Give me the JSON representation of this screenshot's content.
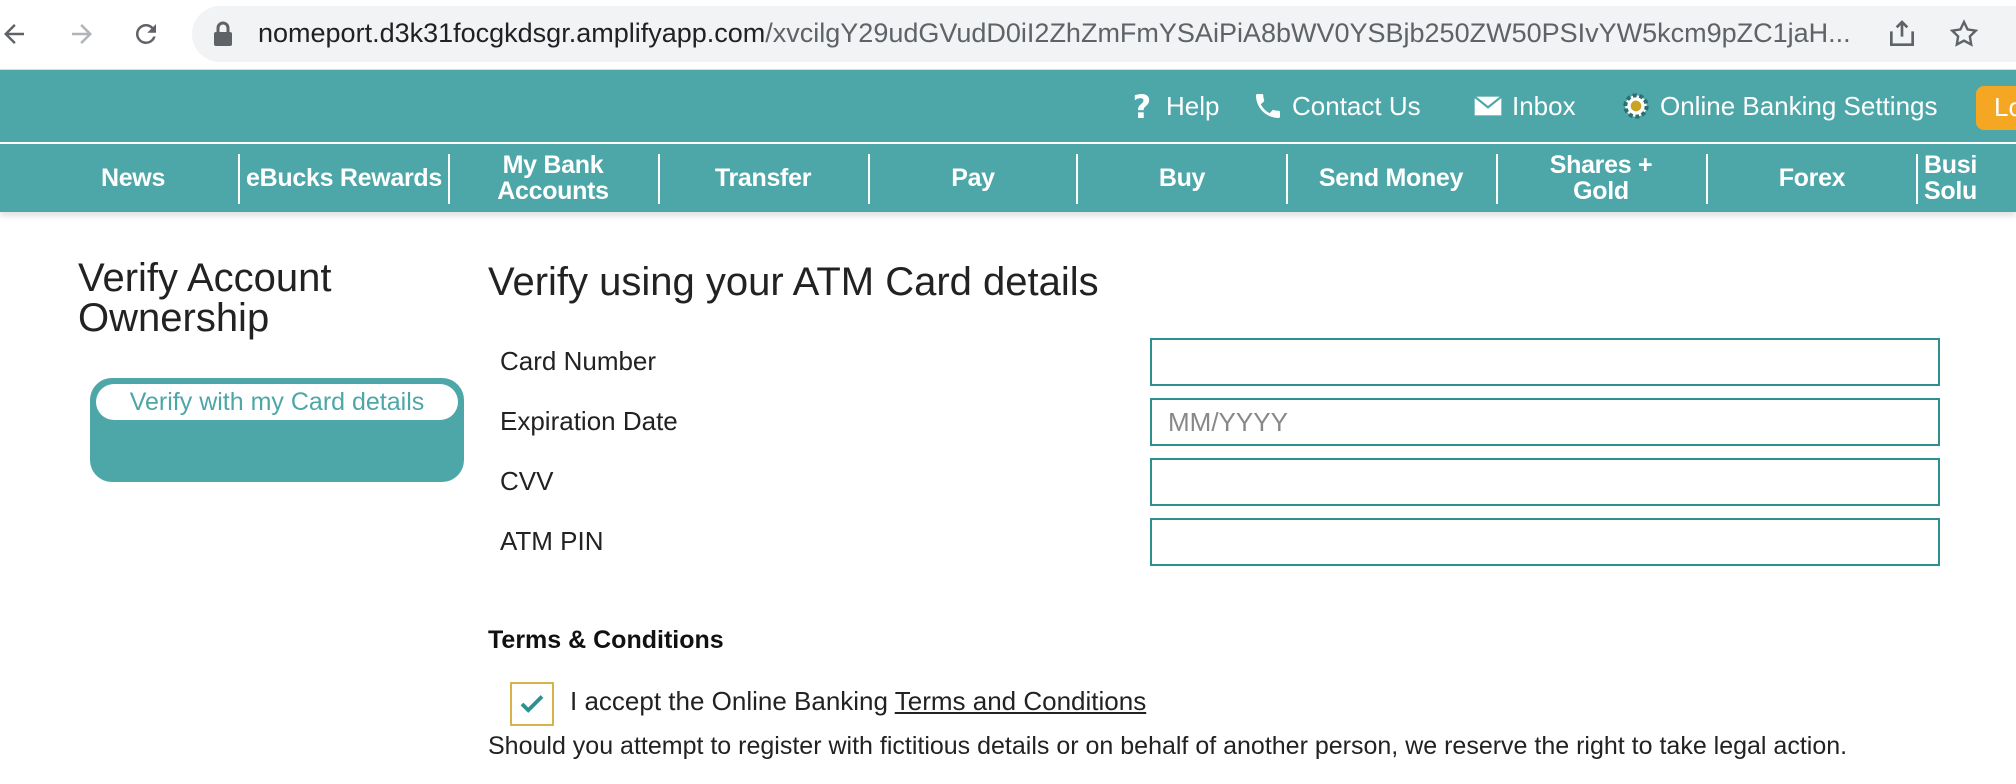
{
  "browser": {
    "url_host": "nomeport.d3k31focgkdsgr.amplifyapp.com",
    "url_path": "/xvcilgY29udGVudD0iI2ZhZmFmYSAiPiA8bWV0YSBjb250ZW50PSIvYW5kcm9pZC1jaH..."
  },
  "topbar": {
    "help": "Help",
    "contact": "Contact Us",
    "inbox": "Inbox",
    "settings": "Online Banking Settings",
    "login": "Lo"
  },
  "mainnav": [
    {
      "label": "News"
    },
    {
      "label": "eBucks Rewards"
    },
    {
      "label": "My Bank\nAccounts"
    },
    {
      "label": "Transfer"
    },
    {
      "label": "Pay"
    },
    {
      "label": "Buy"
    },
    {
      "label": "Send Money"
    },
    {
      "label": "Shares +\nGold"
    },
    {
      "label": "Forex"
    },
    {
      "label": "Busi\nSolu"
    }
  ],
  "sidebar": {
    "title": "Verify Account Ownership",
    "option": "Verify with my Card details"
  },
  "form": {
    "title": "Verify using your ATM Card details",
    "card_number_label": "Card Number",
    "card_number_value": "",
    "expiry_label": "Expiration Date",
    "expiry_placeholder": "MM/YYYY",
    "cvv_label": "CVV",
    "cvv_value": "",
    "pin_label": "ATM PIN",
    "pin_value": ""
  },
  "terms": {
    "title": "Terms & Conditions",
    "accept_prefix": "I accept the Online Banking ",
    "accept_link": "Terms and Conditions",
    "checked": true,
    "warning": "Should you attempt to register with fictitious details or on behalf of another person, we reserve the right to take legal action."
  },
  "colors": {
    "brand_teal": "#4da6a8",
    "login_orange": "#f5a623",
    "input_border": "#2e8f91"
  }
}
